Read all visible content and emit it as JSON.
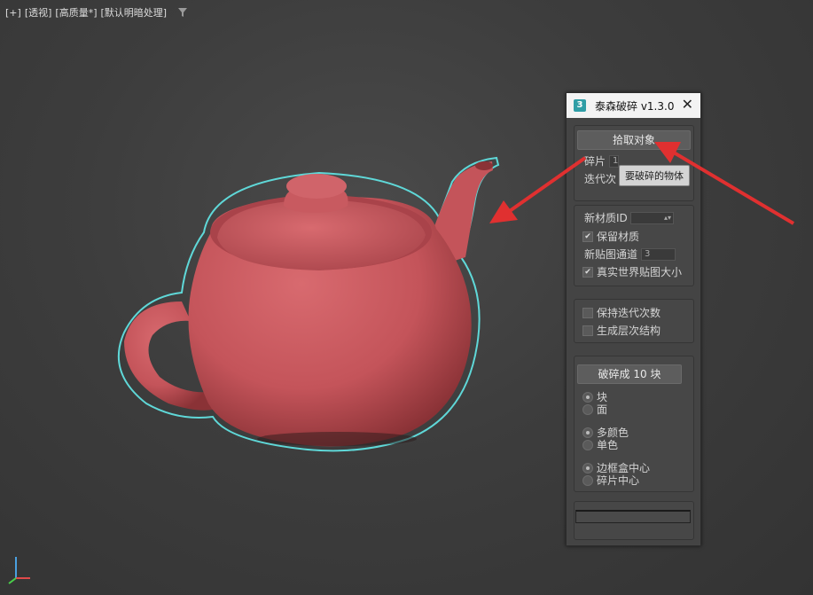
{
  "viewport": {
    "plus": "[+]",
    "view": "[透视]",
    "quality": "[高质量*]",
    "lighting": "[默认明暗处理]"
  },
  "tool": {
    "title": "泰森破碎 v1.3.0",
    "app_icon": "3",
    "close": "✕",
    "pick_button": "拾取对象",
    "tooltip": "要破碎的物体",
    "fragments_label": "碎片",
    "fragments_value": "1",
    "iterations_label": "迭代次",
    "new_material_id_label": "新材质ID",
    "keep_material_label": "保留材质",
    "new_map_channel_label": "新贴图通道",
    "new_map_channel_value": "3",
    "real_world_map_label": "真实世界贴图大小",
    "keep_iterations_label": "保持迭代次数",
    "generate_hierarchy_label": "生成层次结构",
    "break_button": "破碎成 10 块",
    "opt_block": "块",
    "opt_face": "面",
    "opt_multicolor": "多颜色",
    "opt_single": "单色",
    "opt_bbox_center": "边框盒中心",
    "opt_fragment_center": "碎片中心"
  },
  "colors": {
    "teapot": "#c4545a",
    "outline": "#5fd8d8",
    "arrow": "#e03030",
    "accent": "#2f9ea6"
  },
  "icons": [
    "filter-icon",
    "close-icon",
    "app-icon",
    "check-icon",
    "axis-gizmo-icon",
    "arrow-annotation-icon"
  ]
}
